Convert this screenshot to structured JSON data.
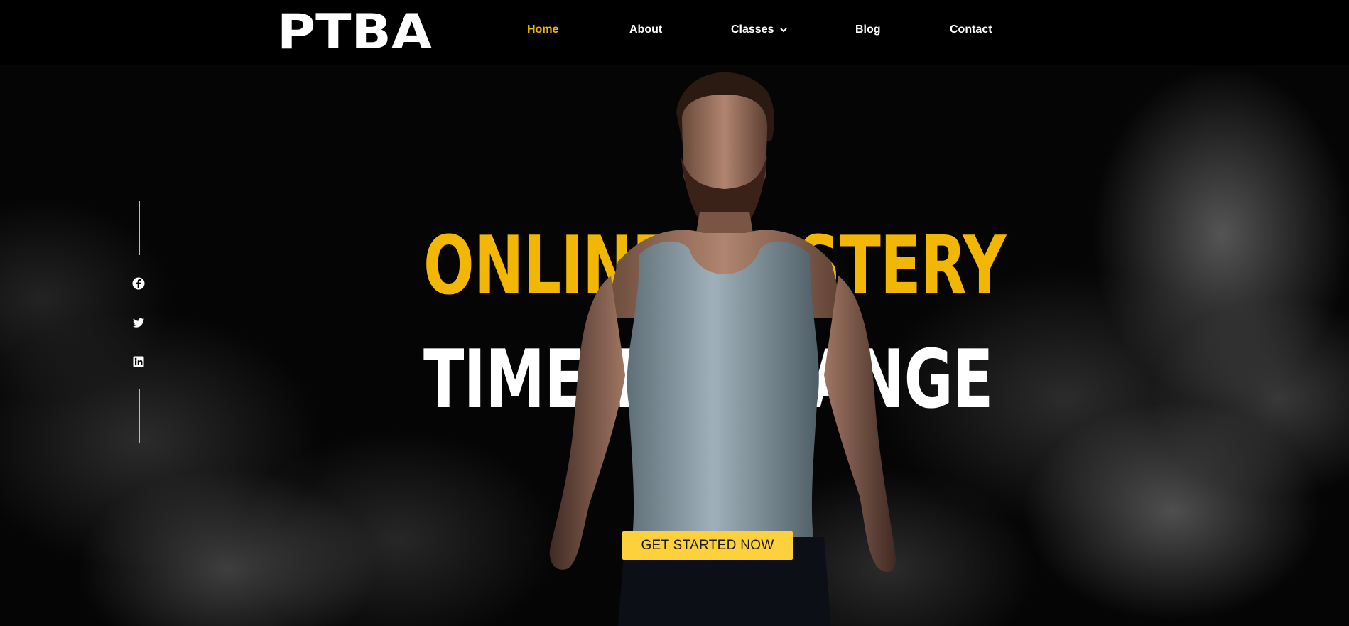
{
  "brand": {
    "logo_text": "PTBA",
    "accent_color": "#f2b705",
    "button_color": "#fcd13b"
  },
  "nav": {
    "items": [
      {
        "label": "Home",
        "active": true
      },
      {
        "label": "About",
        "active": false
      },
      {
        "label": "Classes",
        "active": false,
        "has_dropdown": true
      },
      {
        "label": "Blog",
        "active": false
      },
      {
        "label": "Contact",
        "active": false
      }
    ]
  },
  "social": {
    "icons": [
      "facebook-icon",
      "twitter-icon",
      "linkedin-icon"
    ]
  },
  "hero": {
    "headline_line1": "ONLINE MASTERY",
    "headline_line2": "TIME TO CHANGE",
    "cta_label": "GET STARTED NOW"
  }
}
